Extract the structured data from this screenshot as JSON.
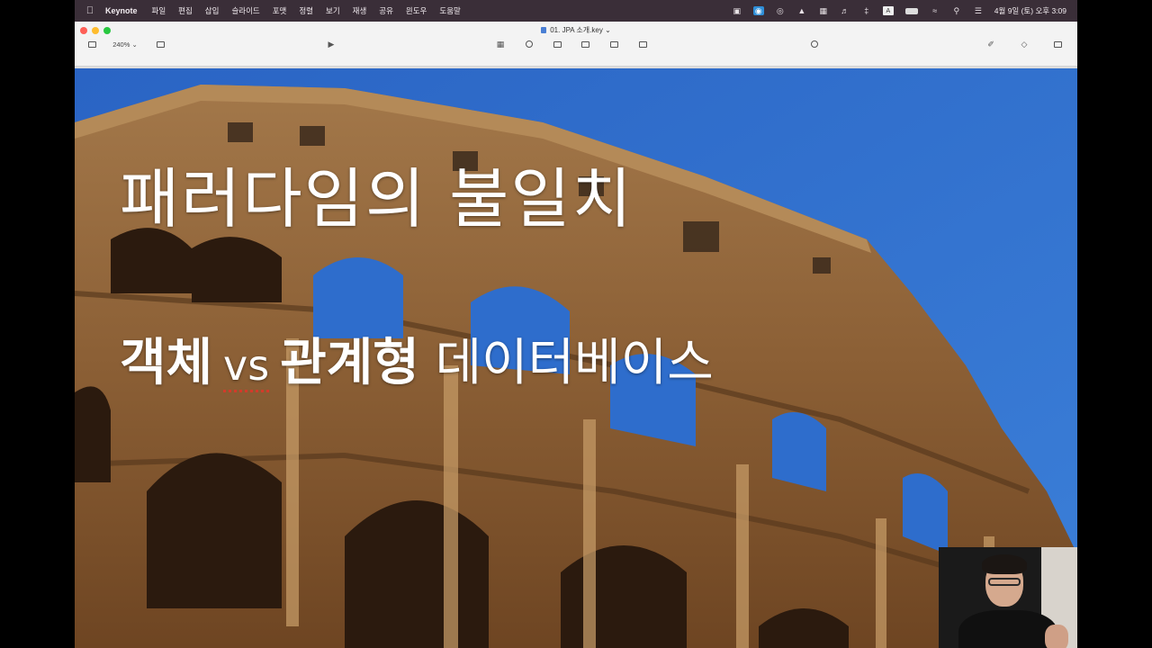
{
  "menubar": {
    "app_name": "Keynote",
    "items": [
      "파일",
      "편집",
      "삽입",
      "슬라이드",
      "포맷",
      "정렬",
      "보기",
      "재생",
      "공유",
      "윈도우",
      "도움말"
    ],
    "clock": "4월 9일 (토) 오후 3:09"
  },
  "window": {
    "doc_title": "01. JPA 소개.key",
    "zoom": "240%"
  },
  "slide": {
    "title": "패러다임의 불일치",
    "subtitle_part1": "객체",
    "subtitle_vs": "vs",
    "subtitle_part2": "관계형",
    "subtitle_part3": "데이터베이스"
  }
}
